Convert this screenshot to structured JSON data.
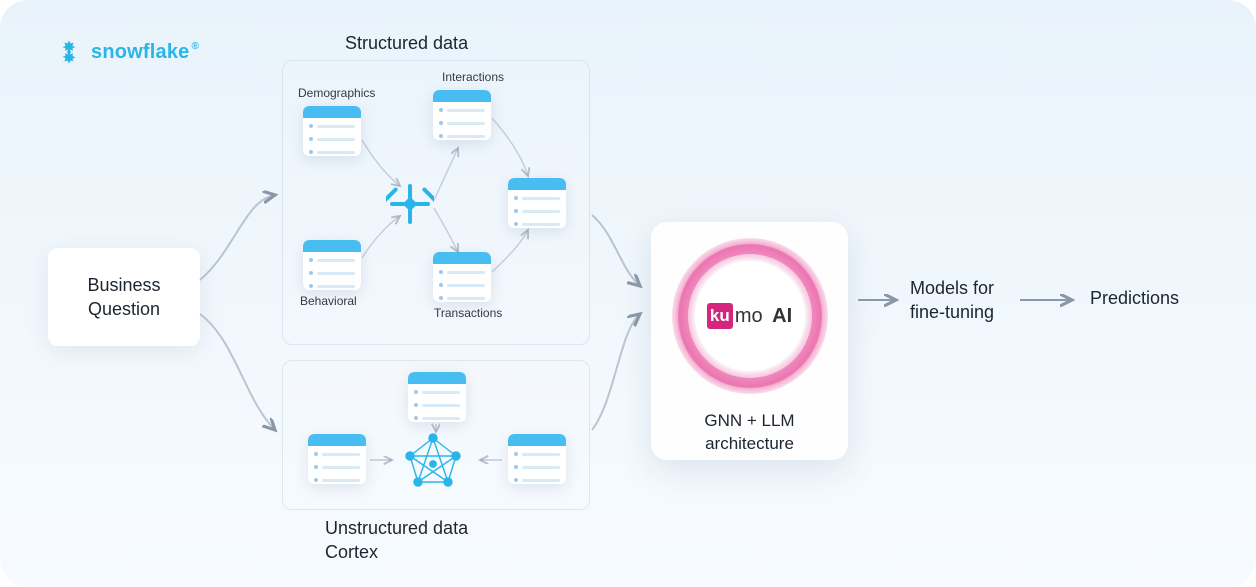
{
  "brand": {
    "snowflake_text": "snowflake",
    "snowflake_color": "#29b5e8",
    "registered_mark": "®"
  },
  "business_question": {
    "label": "Business Question"
  },
  "structured": {
    "title": "Structured data",
    "tables": {
      "demographics": "Demographics",
      "interactions": "Interactions",
      "behavioral": "Behavioral",
      "transactions": "Transactions"
    }
  },
  "unstructured": {
    "line1": "Unstructured data",
    "line2": "Cortex"
  },
  "kumo": {
    "logo_mark": "ku",
    "logo_rest": "mo",
    "logo_suffix": "AI",
    "caption_line1": "GNN + LLM",
    "caption_line2": "architecture",
    "accent": "#d4267e"
  },
  "models": {
    "line1": "Models for",
    "line2": "fine-tuning"
  },
  "predictions": {
    "label": "Predictions"
  }
}
